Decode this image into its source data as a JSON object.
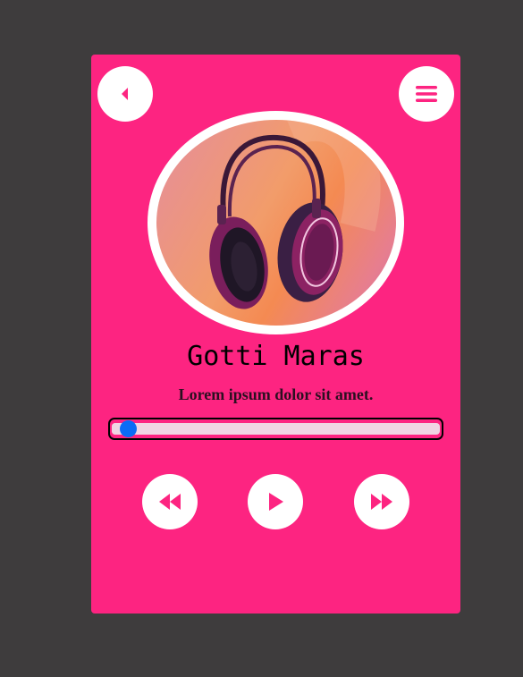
{
  "player": {
    "artist": "Gotti Maras",
    "song_title": "Lorem ipsum dolor sit amet.",
    "progress": 0.03
  },
  "icons": {
    "back": "caret-left-icon",
    "menu": "hamburger-menu-icon",
    "prev": "rewind-icon",
    "play": "play-icon",
    "next": "fast-forward-icon",
    "album": "headphones-image"
  },
  "colors": {
    "card": "#fd2481",
    "background": "#3e3c3d",
    "thumb": "#0a6cf5",
    "button": "#ffffff"
  }
}
